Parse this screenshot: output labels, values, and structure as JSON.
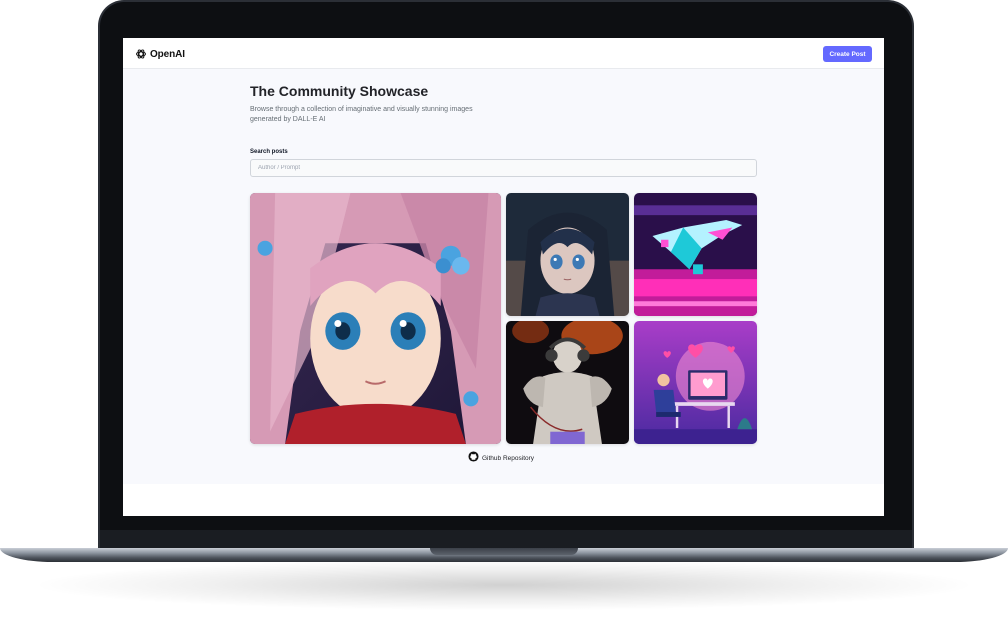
{
  "brand": {
    "name": "OpenAI",
    "logo_icon": "openai-logo-icon",
    "accent_color": "#6469ff"
  },
  "header": {
    "create_button_label": "Create Post"
  },
  "hero": {
    "title": "The Community Showcase",
    "subtitle": "Browse through a collection of imaginative and visually stunning images generated by DALL-E AI"
  },
  "search": {
    "label": "Search posts",
    "placeholder": "Author / Prompt",
    "value": ""
  },
  "gallery": {
    "posts": [
      {
        "icon": "anime-girl-pink-hair-image"
      },
      {
        "icon": "anime-girl-dark-hair-image"
      },
      {
        "icon": "pixel-spaceship-image"
      },
      {
        "icon": "statue-with-headphones-image"
      },
      {
        "icon": "person-at-computer-hearts-image"
      }
    ]
  },
  "footer": {
    "link_label": "Github Repository",
    "link_icon": "github-icon"
  }
}
